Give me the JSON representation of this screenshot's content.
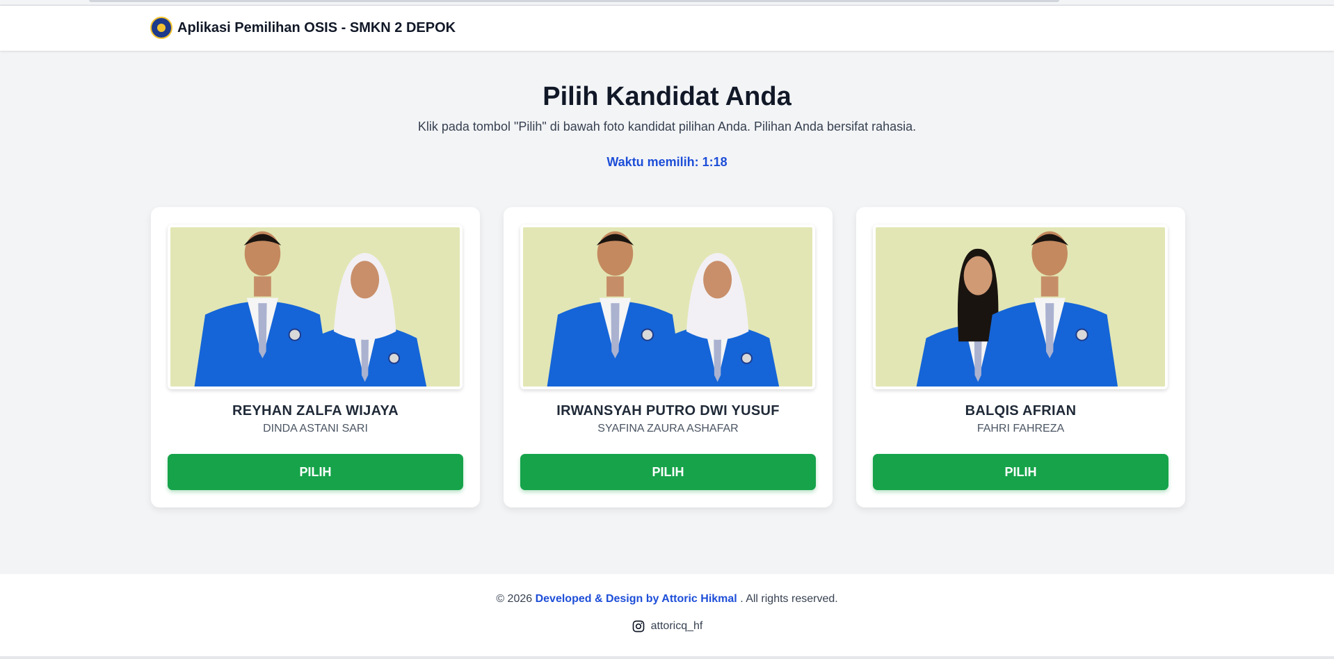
{
  "header": {
    "title": "Aplikasi Pemilihan OSIS - SMKN 2 DEPOK",
    "logo_icon": "school-logo-icon"
  },
  "main": {
    "title": "Pilih Kandidat Anda",
    "subtitle": "Klik pada tombol \"Pilih\" di bawah foto kandidat pilihan Anda. Pilihan Anda bersifat rahasia.",
    "timer": "Waktu memilih: 1:18"
  },
  "candidates": [
    {
      "name": "REYHAN ZALFA WIJAYA",
      "vice": "DINDA ASTANI SARI",
      "button": "PILIH",
      "photo_order": [
        "male",
        "female-hijab"
      ]
    },
    {
      "name": "IRWANSYAH PUTRO DWI YUSUF",
      "vice": "SYAFINA ZAURA ASHAFAR",
      "button": "PILIH",
      "photo_order": [
        "male",
        "female-hijab"
      ]
    },
    {
      "name": "BALQIS AFRIAN",
      "vice": "FAHRI FAHREZA",
      "button": "PILIH",
      "photo_order": [
        "female",
        "male"
      ]
    }
  ],
  "footer": {
    "copyright_prefix": "© 2026",
    "developer_link": "Developed & Design by Attoric Hikmal",
    "copyright_suffix": ". All rights reserved.",
    "instagram_handle": "attoricq_hf"
  },
  "colors": {
    "accent_blue": "#1d4ed8",
    "vote_green": "#16a34a",
    "background": "#f3f4f6",
    "blazer_blue": "#1565d8",
    "photo_backdrop": "#e2e6b4"
  }
}
